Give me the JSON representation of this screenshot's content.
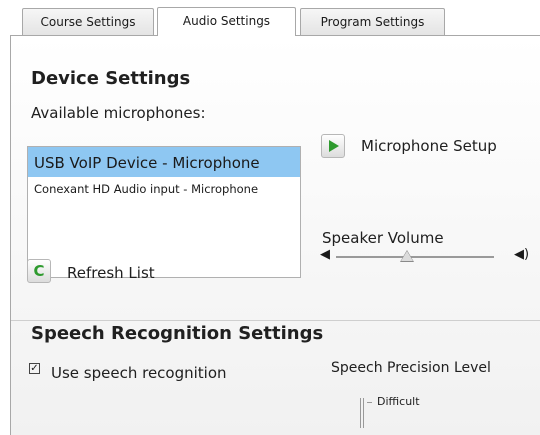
{
  "tabs": [
    {
      "label": "Course Settings",
      "active": false
    },
    {
      "label": "Audio Settings",
      "active": true
    },
    {
      "label": "Program Settings",
      "active": false
    }
  ],
  "device_settings": {
    "title": "Device Settings",
    "available_label": "Available microphones:",
    "microphones": [
      {
        "label": "USB VoIP Device - Microphone",
        "selected": true
      },
      {
        "label": "Conexant HD Audio input - Microphone",
        "selected": false
      }
    ],
    "refresh_label": "Refresh List",
    "mic_setup_label": "Microphone Setup",
    "speaker_volume_label": "Speaker Volume",
    "speaker_volume_level": 0.45
  },
  "speech": {
    "title": "Speech Recognition Settings",
    "use_label": "Use speech recognition",
    "use_checked": true,
    "check_glyph": "✓",
    "precision_label": "Speech Precision Level",
    "level_top_label": "Difficult"
  },
  "colors": {
    "selected_row": "#8ec7f2",
    "play_icon": "#2e9a2e"
  }
}
